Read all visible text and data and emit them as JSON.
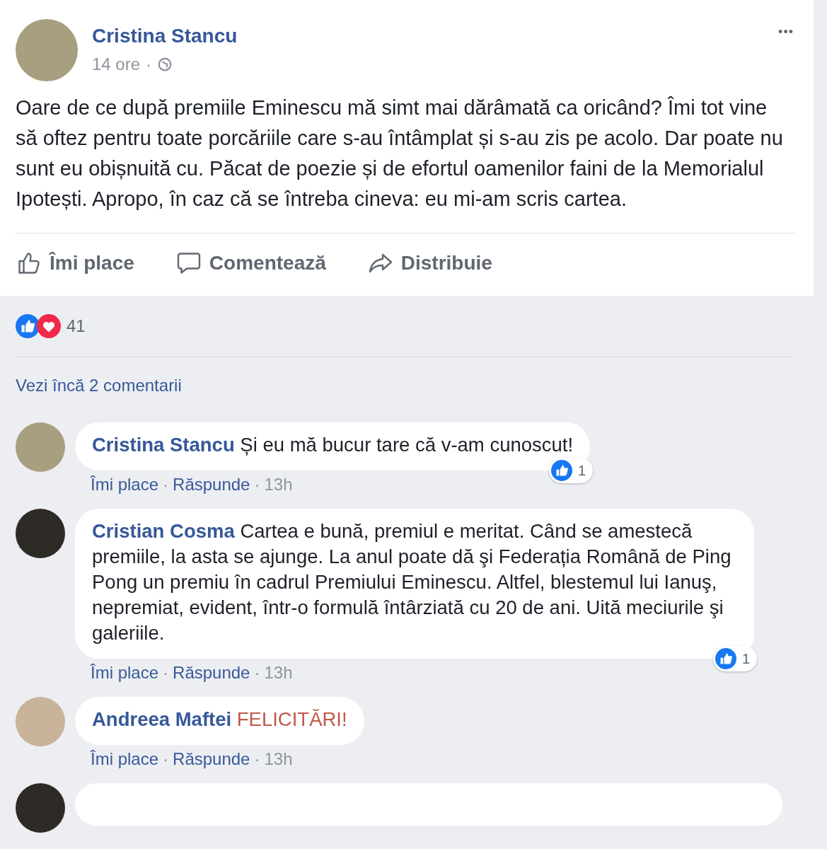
{
  "post": {
    "author": "Cristina Stancu",
    "time": "14 ore",
    "separator": "·",
    "more": "•••",
    "text": "Oare de ce după premiile Eminescu mă simt mai dărâmată ca oricând? Îmi tot vine să oftez pentru toate porcăriile care s-au întâmplat și s-au zis pe acolo. Dar poate nu sunt eu obișnuită cu. Păcat de poezie și de efortul oamenilor faini de la Memorialul Ipotești. Apropo, în caz că se întreba cineva: eu mi-am scris cartea.",
    "actions": [
      {
        "kind": "like",
        "label": "Îmi place"
      },
      {
        "kind": "comment",
        "label": "Comentează"
      },
      {
        "kind": "share",
        "label": "Distribuie"
      }
    ]
  },
  "reactions": {
    "count": "41"
  },
  "more_comments": "Vezi încă 2 comentarii",
  "comments": [
    {
      "kind": "full",
      "author": "Cristina Stancu",
      "text": "Și eu mă bucur tare că v-am cunoscut!",
      "highlighted": false,
      "separator": "·",
      "like": "Îmi place",
      "reply": "Răspunde",
      "time": "13h",
      "reaction_count": "1"
    },
    {
      "kind": "full",
      "author": "Cristian Cosma",
      "text": "Cartea e bună, premiul e meritat. Când se amestecă premiile, la asta se ajunge. La anul poate dă şi Federația Română de Ping Pong un premiu în cadrul Premiului Eminescu. Altfel, blestemul lui Ianuş, nepremiat, evident, într-o formulă întârziată cu 20 de ani. Uită meciurile şi galeriile.",
      "highlighted": false,
      "separator": "·",
      "like": "Îmi place",
      "reply": "Răspunde",
      "time": "13h",
      "reaction_count": "1"
    },
    {
      "kind": "full",
      "author": "Andreea Maftei",
      "text": "FELICITĂRI!",
      "highlighted": true,
      "separator": "·",
      "like": "Îmi place",
      "reply": "Răspunde",
      "time": "13h"
    },
    {
      "kind": "partial"
    }
  ]
}
